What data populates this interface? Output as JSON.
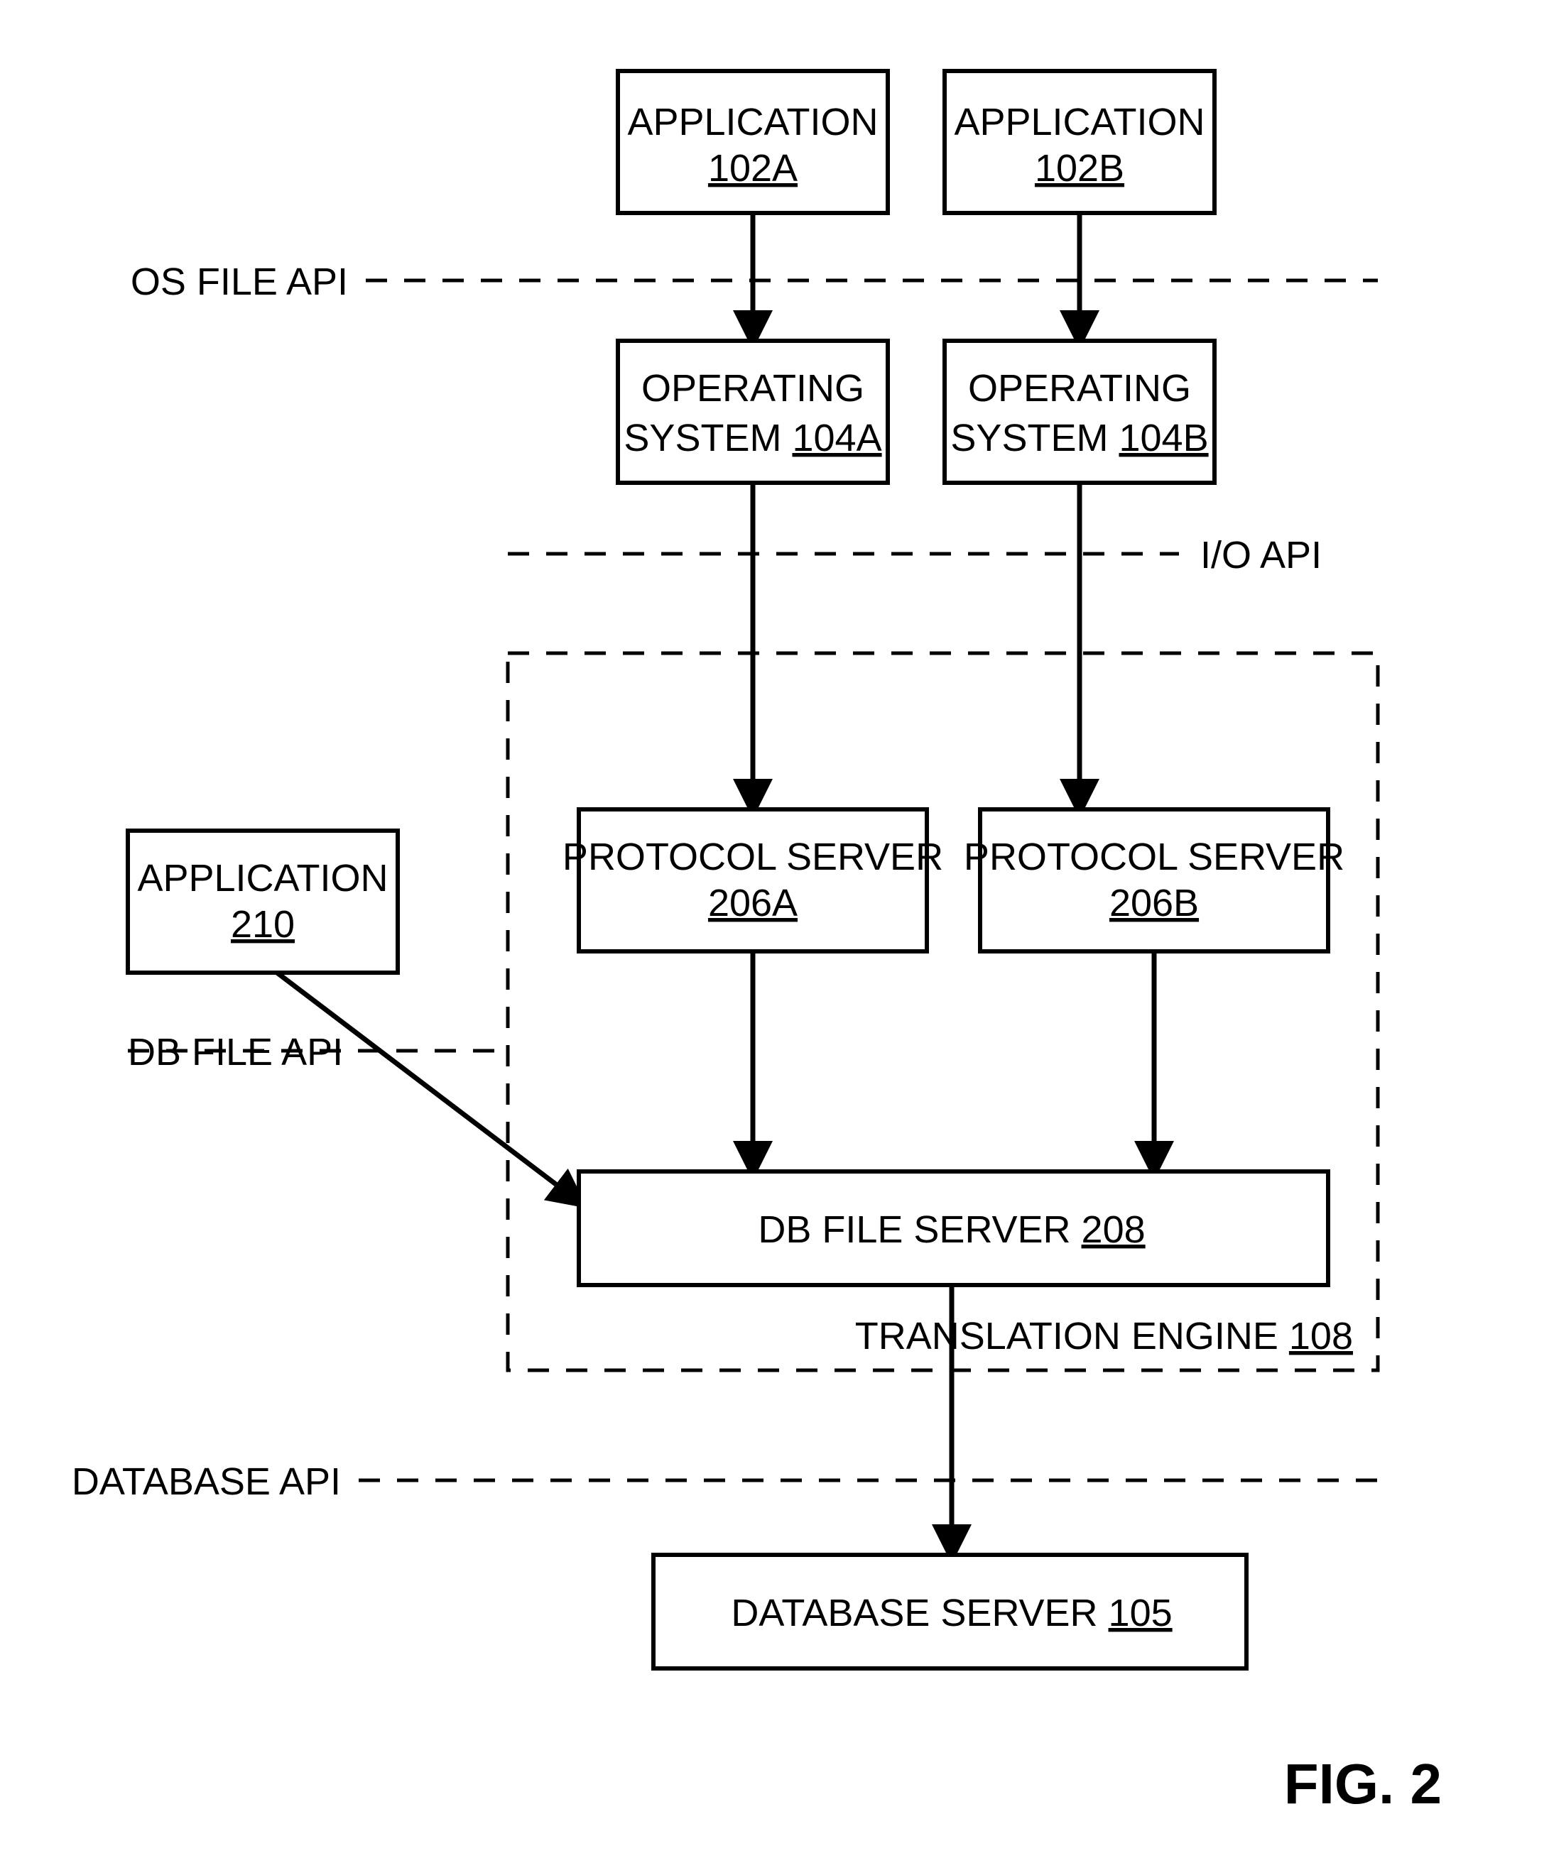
{
  "fig": "FIG. 2",
  "boxes": {
    "app_a": {
      "label": "APPLICATION",
      "ref": "102A"
    },
    "app_b": {
      "label": "APPLICATION",
      "ref": "102B"
    },
    "os_a": {
      "line1": "OPERATING",
      "line2": "SYSTEM",
      "ref": "104A"
    },
    "os_b": {
      "line1": "OPERATING",
      "line2": "SYSTEM",
      "ref": "104B"
    },
    "proto_a": {
      "label": "PROTOCOL SERVER",
      "ref": "206A"
    },
    "proto_b": {
      "label": "PROTOCOL SERVER",
      "ref": "206B"
    },
    "app_210": {
      "label": "APPLICATION",
      "ref": "210"
    },
    "dbfile": {
      "label": "DB FILE SERVER",
      "ref": "208"
    },
    "dbserver": {
      "label": "DATABASE SERVER",
      "ref": "105"
    }
  },
  "layers": {
    "os_file_api": "OS FILE API",
    "io_api": "I/O API",
    "db_file_api": "DB FILE API",
    "database_api": "DATABASE API"
  },
  "engine_label": {
    "label": "TRANSLATION ENGINE",
    "ref": "108"
  }
}
